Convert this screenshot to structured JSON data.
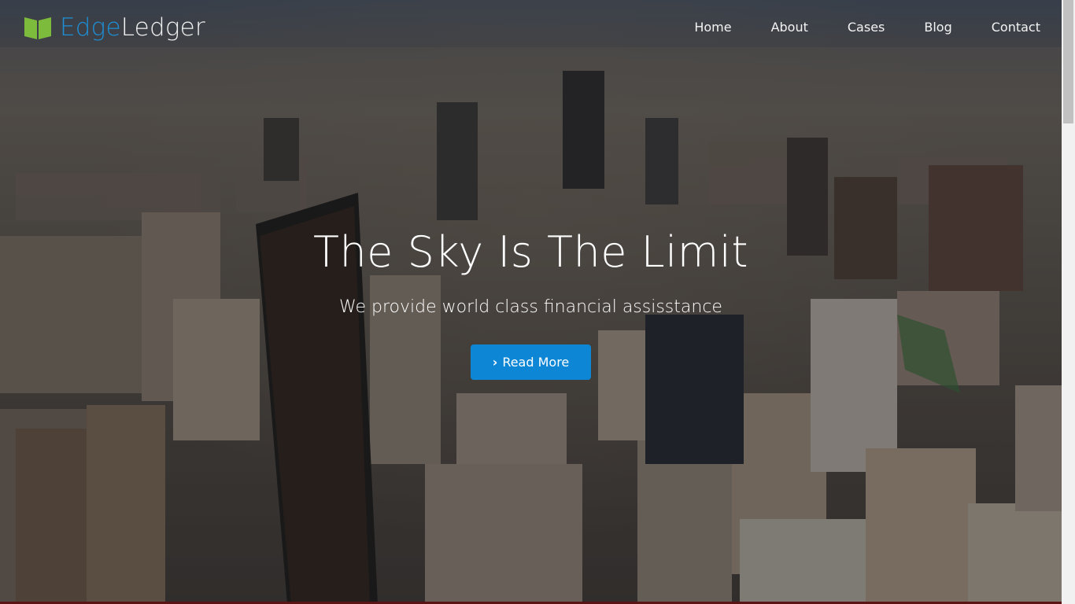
{
  "brand": {
    "part1": "Edge",
    "part2": "Ledger",
    "icon": "book-icon",
    "colors": {
      "accent": "#1e8fd6",
      "icon": "#7dbb3c"
    }
  },
  "nav": {
    "items": [
      "Home",
      "About",
      "Cases",
      "Blog",
      "Contact"
    ]
  },
  "hero": {
    "headline": "The Sky Is The Limit",
    "subtitle": "We provide world class financial assisstance",
    "button": {
      "label": "Read More",
      "icon": "chevron-right-icon",
      "color": "#0d86d6"
    },
    "background": "aerial-city-photo"
  }
}
